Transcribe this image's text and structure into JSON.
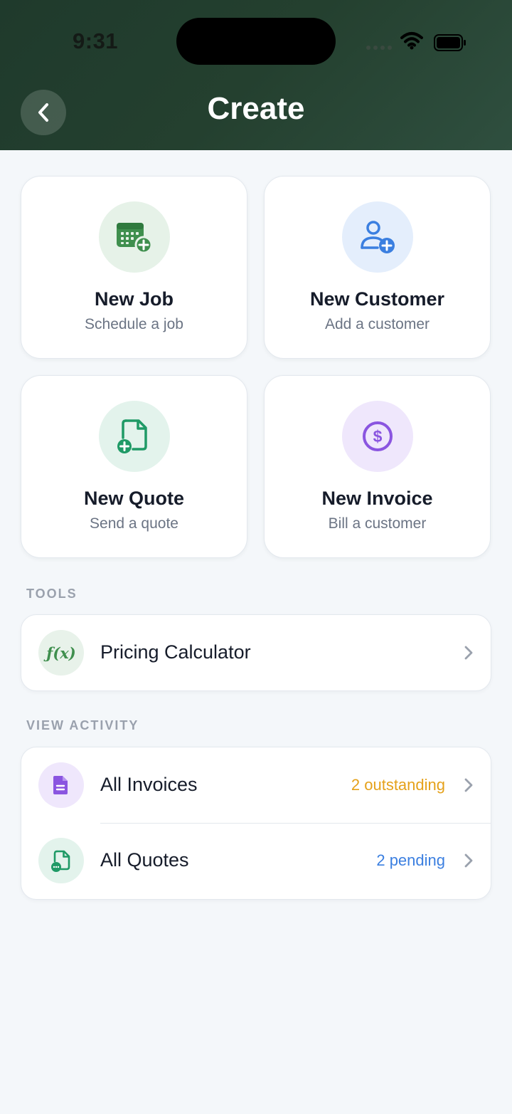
{
  "status_bar": {
    "time": "9:31"
  },
  "header": {
    "title": "Create"
  },
  "cards": [
    {
      "title": "New Job",
      "subtitle": "Schedule a job",
      "icon": "calendar-add-icon",
      "color": "#3f8f4e",
      "bg": "#e6f2e8"
    },
    {
      "title": "New Customer",
      "subtitle": "Add a customer",
      "icon": "user-add-icon",
      "color": "#3b7fe0",
      "bg": "#e4eefc"
    },
    {
      "title": "New Quote",
      "subtitle": "Send a quote",
      "icon": "document-add-icon",
      "color": "#1f9a66",
      "bg": "#e3f3ec"
    },
    {
      "title": "New Invoice",
      "subtitle": "Bill a customer",
      "icon": "dollar-circle-icon",
      "color": "#8a55e0",
      "bg": "#efe7fc"
    }
  ],
  "tools": {
    "label": "TOOLS",
    "items": [
      {
        "label": "Pricing Calculator",
        "icon": "function-icon",
        "icon_text": "ƒ(x)",
        "color": "#3f8f4e"
      }
    ]
  },
  "activity": {
    "label": "VIEW ACTIVITY",
    "items": [
      {
        "label": "All Invoices",
        "badge": "2 outstanding",
        "badge_color": "#e5a11a",
        "icon": "invoice-document-icon"
      },
      {
        "label": "All Quotes",
        "badge": "2 pending",
        "badge_color": "#3b7fe0",
        "icon": "quote-document-icon"
      }
    ]
  }
}
